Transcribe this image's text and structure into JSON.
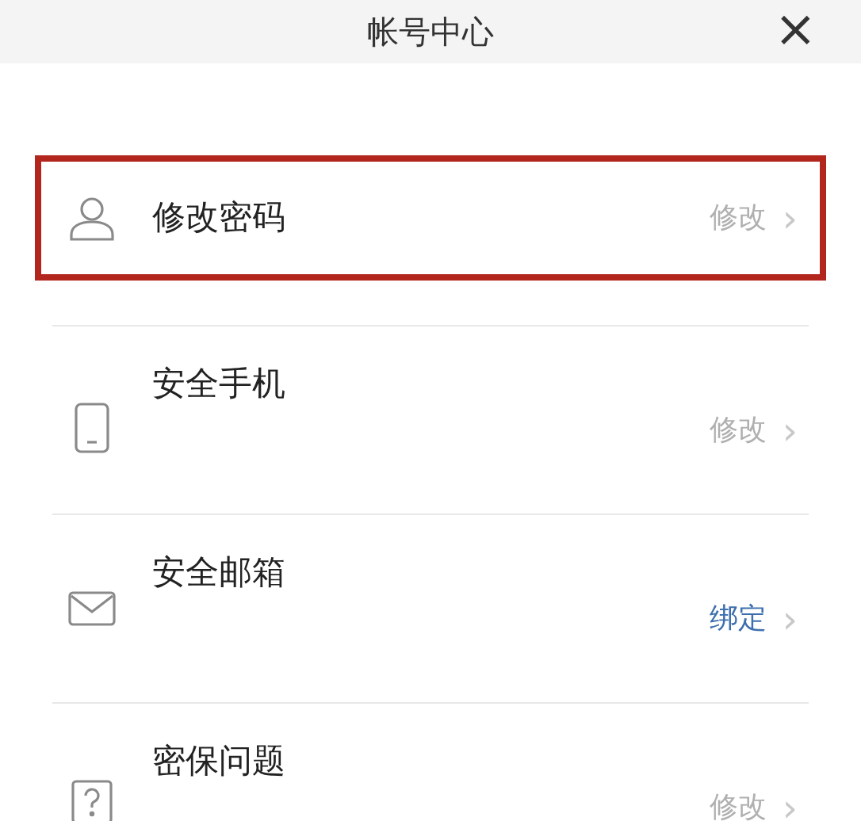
{
  "header": {
    "title": "帐号中心",
    "close": "×"
  },
  "items": [
    {
      "kind": "person",
      "label": "修改密码",
      "action": "修改",
      "color": "#b0b0b0",
      "highlighted": true,
      "chevron": "›"
    },
    {
      "kind": "phone",
      "label": "安全手机",
      "action": "修改",
      "color": "#b0b0b0",
      "highlighted": false,
      "chevron": "›"
    },
    {
      "kind": "mail",
      "label": "安全邮箱",
      "action": "绑定",
      "color": "#3d6fae",
      "highlighted": false,
      "chevron": "›"
    },
    {
      "kind": "question",
      "label": "密保问题",
      "action": "修改",
      "color": "#b0b0b0",
      "highlighted": false,
      "chevron": "›"
    }
  ]
}
